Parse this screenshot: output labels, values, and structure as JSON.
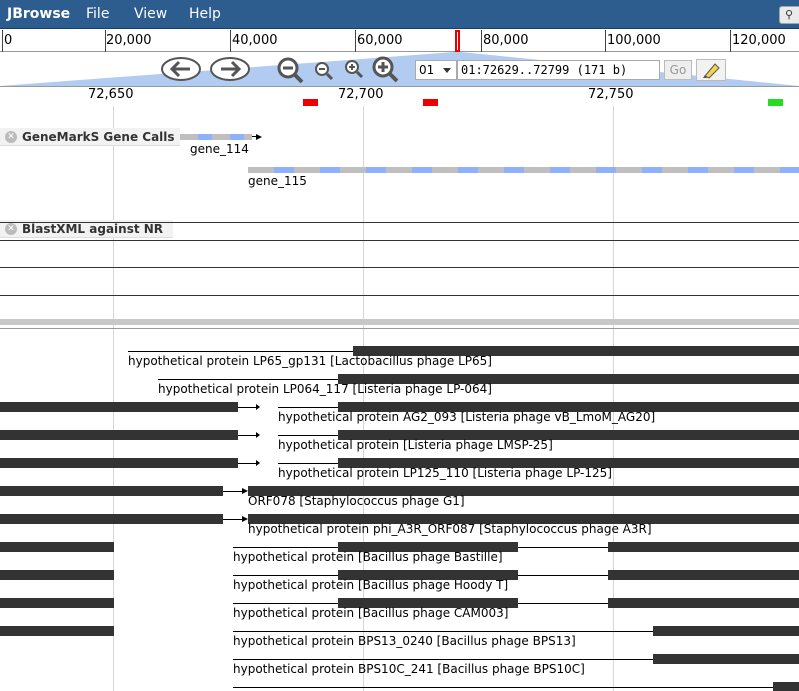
{
  "app": {
    "title": "JBrowse",
    "menus": [
      "File",
      "View",
      "Help"
    ]
  },
  "overview": {
    "tick_labels": [
      "0",
      "20,000",
      "40,000",
      "60,000",
      "80,000",
      "100,000",
      "120,000"
    ]
  },
  "navigation": {
    "sequence_select": "01",
    "location": "01:72629..72799 (171 b)",
    "go_label": "Go"
  },
  "detail_ruler": {
    "tick_labels": [
      "72,650",
      "72,700",
      "72,750"
    ]
  },
  "tracks": {
    "genemark": {
      "title": "GeneMarkS Gene Calls",
      "genes": [
        "gene_114",
        "gene_115"
      ]
    },
    "blast": {
      "title": "BlastXML against NR",
      "hits": [
        "hypothetical protein LP65_gp131 [Lactobacillus phage LP65]",
        "hypothetical protein LP064_117 [Listeria phage LP-064]",
        "hypothetical protein AG2_093 [Listeria phage vB_LmoM_AG20]",
        "hypothetical protein [Listeria phage LMSP-25]",
        "hypothetical protein LP125_110 [Listeria phage LP-125]",
        "ORF078 [Staphylococcus phage G1]",
        "hypothetical protein phi_A3R_ORF087 [Staphylococcus phage A3R]",
        "hypothetical protein [Bacillus phage Bastille]",
        "hypothetical protein [Bacillus phage Hoody T]",
        "hypothetical protein [Bacillus phage CAM003]",
        "hypothetical protein BPS13_0240 [Bacillus phage BPS13]",
        "hypothetical protein BPS10C_241 [Bacillus phage BPS10C]"
      ]
    }
  },
  "colors": {
    "menubar": "#2d5d8f",
    "gene_blue": "#8fb0ff",
    "gene_gray": "#bfbfbf",
    "hit": "#333333",
    "marker_red": "#ee0000",
    "marker_green": "#22dd22"
  }
}
